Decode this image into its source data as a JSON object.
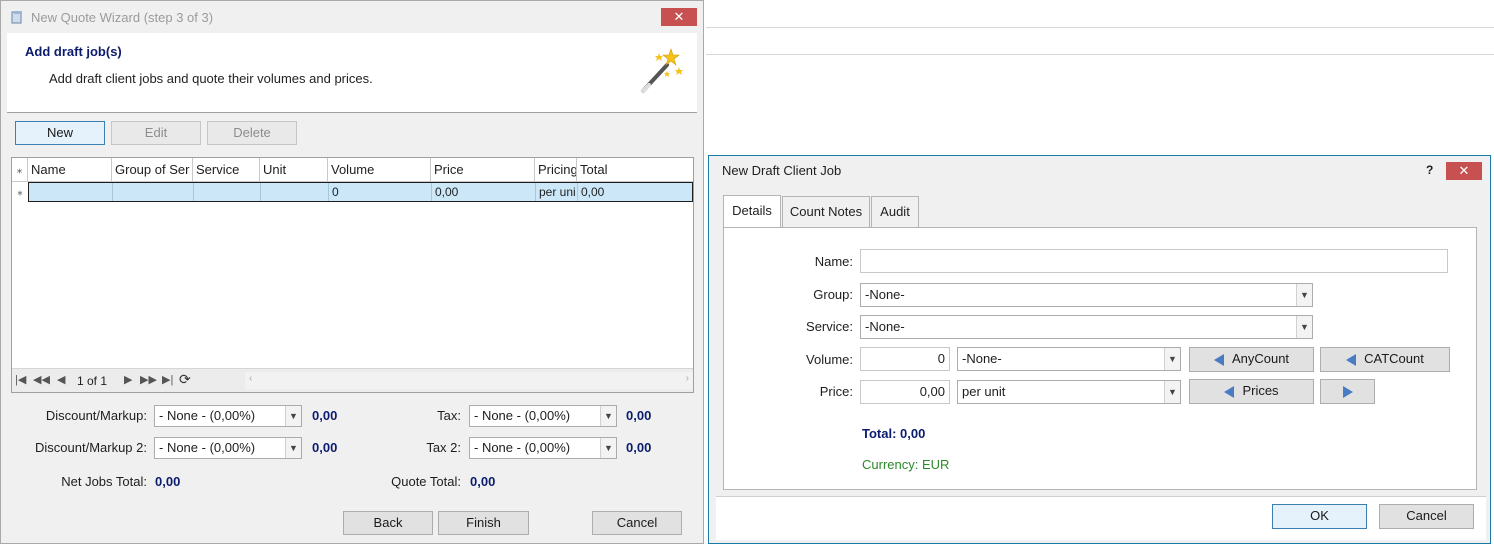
{
  "wizard": {
    "title": "New Quote Wizard  (step 3 of 3)",
    "close_glyph": "✕",
    "header_title": "Add draft job(s)",
    "header_subtitle": "Add draft client jobs and quote their volumes and prices.",
    "toolbar": {
      "new_label": "New",
      "edit_label": "Edit",
      "delete_label": "Delete"
    },
    "grid": {
      "columns": [
        "Name",
        "Group of Ser",
        "Service",
        "Unit",
        "Volume",
        "Price",
        "Pricing",
        "Total"
      ],
      "row": {
        "name": "",
        "group": "",
        "service": "",
        "unit": "",
        "volume": "0",
        "price": "0,00",
        "pricing": "per uni",
        "total": "0,00"
      },
      "page_info": "1 of 1"
    },
    "summary": {
      "discount_label": "Discount/Markup:",
      "discount_value": "- None - (0,00%)",
      "discount_amount": "0,00",
      "discount2_label": "Discount/Markup 2:",
      "discount2_value": "- None - (0,00%)",
      "discount2_amount": "0,00",
      "tax_label": "Tax:",
      "tax_value": "- None - (0,00%)",
      "tax_amount": "0,00",
      "tax2_label": "Tax 2:",
      "tax2_value": "- None - (0,00%)",
      "tax2_amount": "0,00",
      "net_jobs_label": "Net Jobs Total:",
      "net_jobs_value": "0,00",
      "quote_total_label": "Quote Total:",
      "quote_total_value": "0,00"
    },
    "footer": {
      "back_label": "Back",
      "finish_label": "Finish",
      "cancel_label": "Cancel"
    }
  },
  "dialog": {
    "title": "New Draft Client Job",
    "help_glyph": "?",
    "close_glyph": "✕",
    "tabs": [
      "Details",
      "Count Notes",
      "Audit"
    ],
    "fields": {
      "name_label": "Name:",
      "name_value": "",
      "group_label": "Group:",
      "group_value": "-None-",
      "service_label": "Service:",
      "service_value": "-None-",
      "volume_label": "Volume:",
      "volume_value": "0",
      "volume_unit": "-None-",
      "anycount_label": "AnyCount",
      "catcount_label": "CATCount",
      "price_label": "Price:",
      "price_value": "0,00",
      "price_mode": "per unit",
      "prices_label": "Prices"
    },
    "total_text": "Total: 0,00",
    "currency_text": "Currency: EUR",
    "ok_label": "OK",
    "cancel_label": "Cancel"
  }
}
